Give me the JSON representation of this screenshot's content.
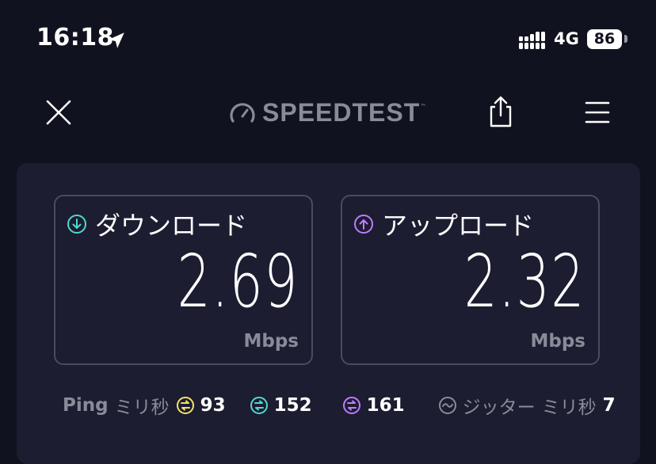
{
  "status_bar": {
    "time": "16:18",
    "network": "4G",
    "battery": "86"
  },
  "nav": {
    "logo_text": "SPEEDTEST",
    "logo_tm": "™"
  },
  "results": {
    "download": {
      "title": "ダウンロード",
      "value": "2.69",
      "unit": "Mbps",
      "icon": "download-arrow-icon",
      "color": "#4fd8d0"
    },
    "upload": {
      "title": "アップロード",
      "value": "2.32",
      "unit": "Mbps",
      "icon": "upload-arrow-icon",
      "color": "#c17cff"
    }
  },
  "ping": {
    "label": "Ping",
    "unit": "ミリ秒",
    "idle": {
      "value": "93",
      "color": "#f4e36a"
    },
    "download": {
      "value": "152",
      "color": "#4fd8d0"
    },
    "upload": {
      "value": "161",
      "color": "#c17cff"
    }
  },
  "jitter": {
    "label": "ジッター",
    "unit": "ミリ秒",
    "value": "7"
  }
}
